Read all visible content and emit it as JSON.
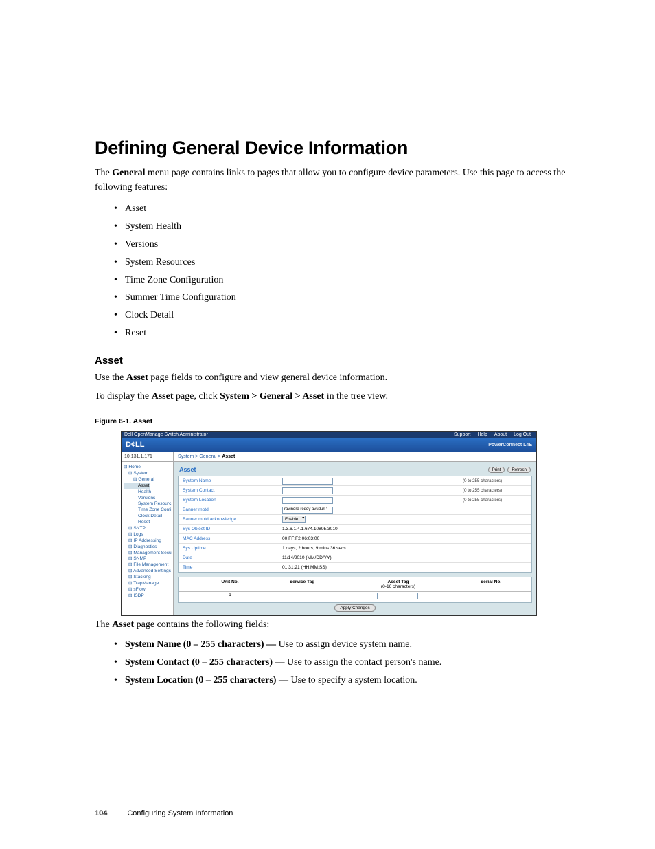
{
  "heading": "Defining General Device Information",
  "intro_prefix": "The ",
  "intro_bold1": "General",
  "intro_mid": " menu page contains links to pages that allow you to configure device parameters. Use this page to access the following features:",
  "features": [
    "Asset",
    "System Health",
    "Versions",
    "System Resources",
    "Time Zone Configuration",
    "Summer Time Configuration",
    "Clock Detail",
    "Reset"
  ],
  "sub_heading": "Asset",
  "para1_a": "Use the ",
  "para1_b": "Asset",
  "para1_c": " page fields to configure and view general device information.",
  "para2_a": "To display the ",
  "para2_b": "Asset",
  "para2_c": " page, click ",
  "para2_d": "System > General > Asset",
  "para2_e": " in the tree view.",
  "figcap": "Figure 6-1.    Asset",
  "shot": {
    "topbar_left": "Dell OpenManage Switch Administrator",
    "topbar_links": [
      "Support",
      "Help",
      "About",
      "Log Out"
    ],
    "brand": "D¢LL",
    "brand_right": "PowerConnect L4E",
    "crumb_left": "10.131.1.171",
    "crumb_links": "System > General > ",
    "crumb_bold": "Asset",
    "tree_home": "Home",
    "tree_system": "System",
    "tree_general": "General",
    "tree_items1": [
      "Asset",
      "Health",
      "Versions",
      "System Resourc",
      "Time Zone Confi",
      "Clock Detail",
      "Reset"
    ],
    "tree_items2": [
      "SNTP",
      "Logs",
      "IP Addressing",
      "Diagnostics",
      "Management Secu",
      "SNMP",
      "File Management",
      "Advanced Settings",
      "Stacking",
      "TrapManage",
      "sFlow",
      "ISDP"
    ],
    "main_title": "Asset",
    "btn_print": "Print",
    "btn_refresh": "Refresh",
    "rows": {
      "sysname_l": "System Name",
      "sysname_h": "(0 to 255 characters)",
      "syscontact_l": "System Contact",
      "syscontact_h": "(0 to 255 characters)",
      "sysloc_l": "System Location",
      "sysloc_h": "(0 to 255 characters)",
      "banner_l": "Banner motd",
      "banner_v": "ravindra reddy avuduri \\",
      "ack_l": "Banner motd acknowledge",
      "ack_v": "Enable",
      "oid_l": "Sys Object ID",
      "oid_v": "1.3.6.1.4.1.674.10895.3010",
      "mac_l": "MAC Address",
      "mac_v": "00:FF:F2:06:03:00",
      "up_l": "Sys Uptime",
      "up_v": "1 days, 2 hours, 9 mins 36 secs",
      "date_l": "Date",
      "date_v": "11/14/2010 (MM/DD/YY)",
      "time_l": "Time",
      "time_v": "01:31:21 (HH:MM:SS)"
    },
    "tcol1": "Unit No.",
    "tcol2": "Service Tag",
    "tcol3a": "Asset Tag",
    "tcol3b": "(0-16 characters)",
    "tcol4": "Serial No.",
    "trow_unit": "1",
    "apply": "Apply Changes"
  },
  "aftershot_a": "The ",
  "aftershot_b": "Asset",
  "aftershot_c": " page contains the following fields:",
  "fields": [
    {
      "b": "System Name (0 – 255 characters) — ",
      "t": "Use to assign device system name."
    },
    {
      "b": "System Contact (0 – 255 characters) — ",
      "t": "Use to assign the contact person's name."
    },
    {
      "b": "System Location (0 – 255 characters) — ",
      "t": "Use to specify a system location."
    }
  ],
  "footer_page": "104",
  "footer_text": "Configuring System Information"
}
